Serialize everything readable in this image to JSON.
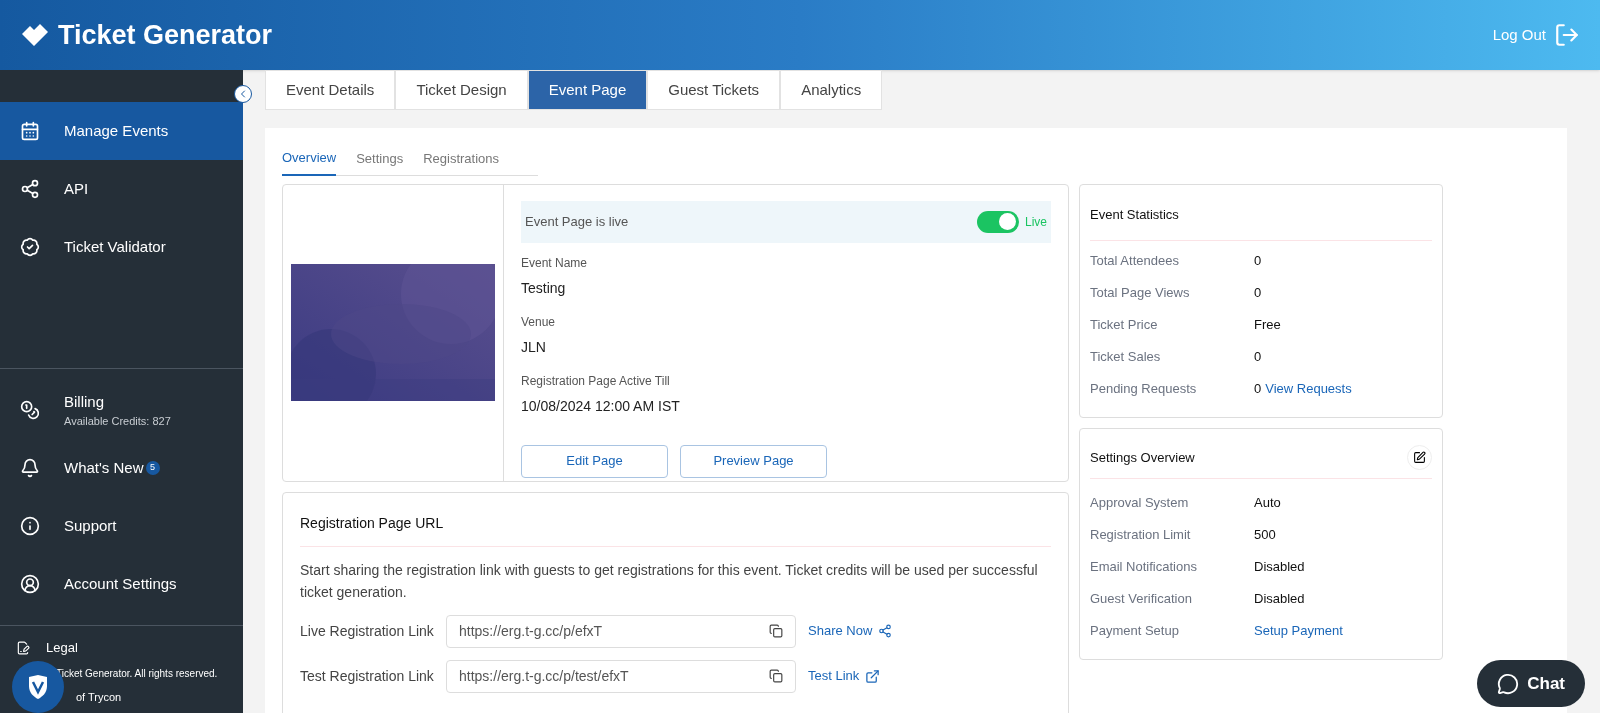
{
  "header": {
    "brand": "Ticket Generator",
    "logout": "Log Out"
  },
  "sidebar": {
    "items": [
      {
        "label": "Manage Events",
        "selected": true
      },
      {
        "label": "API",
        "selected": false
      },
      {
        "label": "Ticket Validator",
        "selected": false
      }
    ],
    "account_items": [
      {
        "label": "Billing",
        "sub": "Available Credits: 827"
      },
      {
        "label": "What's New",
        "badge": "5"
      },
      {
        "label": "Support"
      },
      {
        "label": "Account Settings"
      }
    ],
    "legal": "Legal",
    "copyright": "Ticket Generator. All rights reserved.",
    "owner": "of Trycon"
  },
  "tabs": [
    {
      "label": "Event Details",
      "selected": false
    },
    {
      "label": "Ticket Design",
      "selected": false
    },
    {
      "label": "Event Page",
      "selected": true
    },
    {
      "label": "Guest Tickets",
      "selected": false
    },
    {
      "label": "Analytics",
      "selected": false
    }
  ],
  "subtabs": [
    {
      "label": "Overview",
      "selected": true
    },
    {
      "label": "Settings",
      "selected": false
    },
    {
      "label": "Registrations",
      "selected": false
    }
  ],
  "event": {
    "status_text": "Event Page is live",
    "live": {
      "on": true,
      "label": "Live"
    },
    "fields": [
      {
        "label": "Event Name",
        "value": "Testing"
      },
      {
        "label": "Venue",
        "value": "JLN"
      },
      {
        "label": "Registration Page Active Till",
        "value": "10/08/2024 12:00 AM IST"
      }
    ],
    "buttons": [
      "Edit Page",
      "Preview Page"
    ]
  },
  "registration": {
    "title": "Registration Page URL",
    "description": "Start sharing the registration link with guests to get registrations for this event. Ticket credits will be used per successful ticket generation.",
    "links": [
      {
        "label": "Live Registration Link",
        "url": "https://erg.t-g.cc/p/efxT",
        "action": "Share Now",
        "kind": "share"
      },
      {
        "label": "Test Registration Link",
        "url": "https://erg.t-g.cc/p/test/efxT",
        "action": "Test Link",
        "kind": "external"
      }
    ]
  },
  "statistics": {
    "title": "Event Statistics",
    "rows": [
      {
        "label": "Total Attendees",
        "value": "0",
        "kind": "text"
      },
      {
        "label": "Total Page Views",
        "value": "0",
        "kind": "text"
      },
      {
        "label": "Ticket Price",
        "value": "Free",
        "kind": "text"
      },
      {
        "label": "Ticket Sales",
        "value": "0",
        "kind": "text"
      },
      {
        "label": "Pending Requests",
        "value": "0",
        "link": "View Requests",
        "kind": "text"
      }
    ]
  },
  "settings": {
    "title": "Settings Overview",
    "rows": [
      {
        "label": "Approval System",
        "value": "Auto",
        "kind": "text"
      },
      {
        "label": "Registration Limit",
        "value": "500",
        "kind": "text"
      },
      {
        "label": "Email Notifications",
        "value": "Disabled",
        "kind": "text"
      },
      {
        "label": "Guest Verification",
        "value": "Disabled",
        "kind": "text"
      },
      {
        "label": "Payment Setup",
        "value": "Setup Payment",
        "kind": "link"
      }
    ]
  },
  "chat": {
    "label": "Chat"
  }
}
